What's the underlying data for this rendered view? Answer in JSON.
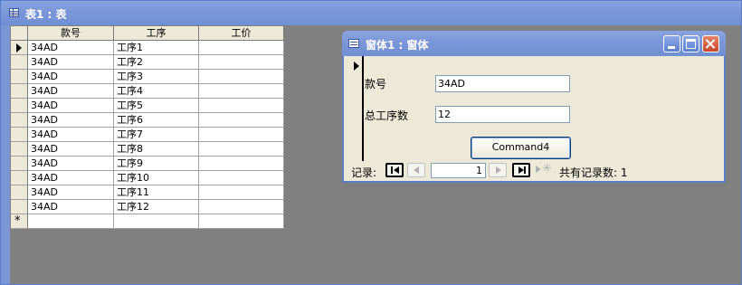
{
  "table_window": {
    "title": "表1 : 表",
    "columns": [
      "款号",
      "工序",
      "工价"
    ],
    "rows": [
      {
        "kuanhao": "34AD",
        "gongxu": "工序1",
        "gongjia": ""
      },
      {
        "kuanhao": "34AD",
        "gongxu": "工序2",
        "gongjia": ""
      },
      {
        "kuanhao": "34AD",
        "gongxu": "工序3",
        "gongjia": ""
      },
      {
        "kuanhao": "34AD",
        "gongxu": "工序4",
        "gongjia": ""
      },
      {
        "kuanhao": "34AD",
        "gongxu": "工序5",
        "gongjia": ""
      },
      {
        "kuanhao": "34AD",
        "gongxu": "工序6",
        "gongjia": ""
      },
      {
        "kuanhao": "34AD",
        "gongxu": "工序7",
        "gongjia": ""
      },
      {
        "kuanhao": "34AD",
        "gongxu": "工序8",
        "gongjia": ""
      },
      {
        "kuanhao": "34AD",
        "gongxu": "工序9",
        "gongjia": ""
      },
      {
        "kuanhao": "34AD",
        "gongxu": "工序10",
        "gongjia": ""
      },
      {
        "kuanhao": "34AD",
        "gongxu": "工序11",
        "gongjia": ""
      },
      {
        "kuanhao": "34AD",
        "gongxu": "工序12",
        "gongjia": ""
      }
    ],
    "new_row_marker": "*"
  },
  "form_window": {
    "title": "窗体1 : 窗体",
    "fields": {
      "kuanhao_label": "款号",
      "kuanhao_value": "34AD",
      "zonggongxu_label": "总工序数",
      "zonggongxu_value": "12"
    },
    "command_button_label": "Command4",
    "navigation": {
      "label": "记录:",
      "current_record": "1",
      "total_text": "共有记录数: 1"
    }
  },
  "colors": {
    "titlebar": "#7b97d8",
    "workspace": "#808080",
    "form_background": "#ece9d8"
  }
}
